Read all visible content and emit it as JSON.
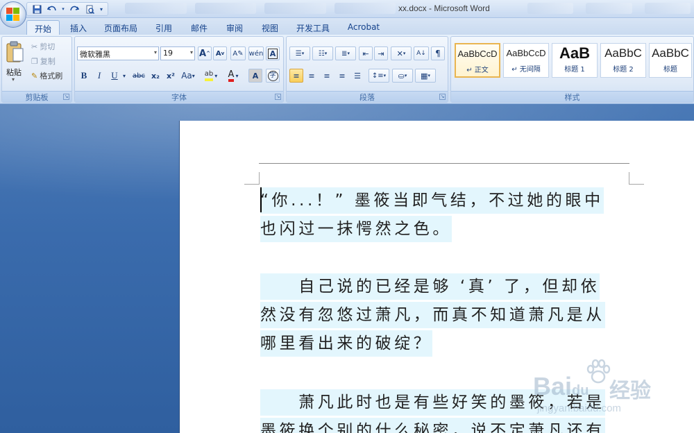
{
  "window": {
    "title": "xx.docx - Microsoft Word"
  },
  "qat": {
    "items": [
      "save-icon",
      "undo-icon",
      "redo-icon",
      "print-preview-icon",
      "customize-icon"
    ]
  },
  "tabs": [
    {
      "label": "开始",
      "active": true
    },
    {
      "label": "插入"
    },
    {
      "label": "页面布局"
    },
    {
      "label": "引用"
    },
    {
      "label": "邮件"
    },
    {
      "label": "审阅"
    },
    {
      "label": "视图"
    },
    {
      "label": "开发工具"
    },
    {
      "label": "Acrobat"
    }
  ],
  "clipboard": {
    "paste": "粘贴",
    "cut": "剪切",
    "copy": "复制",
    "format_painter": "格式刷",
    "label": "剪贴板"
  },
  "font": {
    "name": "微软雅黑",
    "size": "19",
    "label": "字体",
    "grow": "A",
    "shrink": "A",
    "bold": "B",
    "italic": "I",
    "underline": "U",
    "strike": "abc",
    "subscript": "x₂",
    "superscript": "x²",
    "change_case": "Aa",
    "phonetic": "wén",
    "char_border": "A",
    "font_color": "A",
    "char_shading": "A",
    "enclose": "字",
    "highlight_color": "#f7f23a",
    "font_color_value": "#e01f1f"
  },
  "paragraph": {
    "label": "段落"
  },
  "styles": {
    "label": "样式",
    "tiles": [
      {
        "sample": "AaBbCcD",
        "name": "正文",
        "selected": true
      },
      {
        "sample": "AaBbCcD",
        "name": "无间隔"
      },
      {
        "sample": "AaB",
        "name": "标题 1"
      },
      {
        "sample": "AaBbC",
        "name": "标题 2"
      },
      {
        "sample": "AaBbC",
        "name": "标题"
      }
    ]
  },
  "document": {
    "paragraphs": [
      [
        "“你...！” 墨筱当即气结，不过她的眼中",
        "也闪过一抹愕然之色。"
      ],
      [
        "　　自己说的已经是够 ‘真’ 了，但却依",
        "然没有忽悠过萧凡，而真不知道萧凡是从",
        "哪里看出来的破绽？"
      ],
      [
        "　　萧凡此时也是有些好笑的墨筱，若是",
        "墨筱换个别的什么秘密，说不定萧凡还有"
      ]
    ]
  },
  "watermark": {
    "brand": "Bai",
    "brand2": "du",
    "cn": "经验",
    "url": "jingyan.baidu.com"
  }
}
